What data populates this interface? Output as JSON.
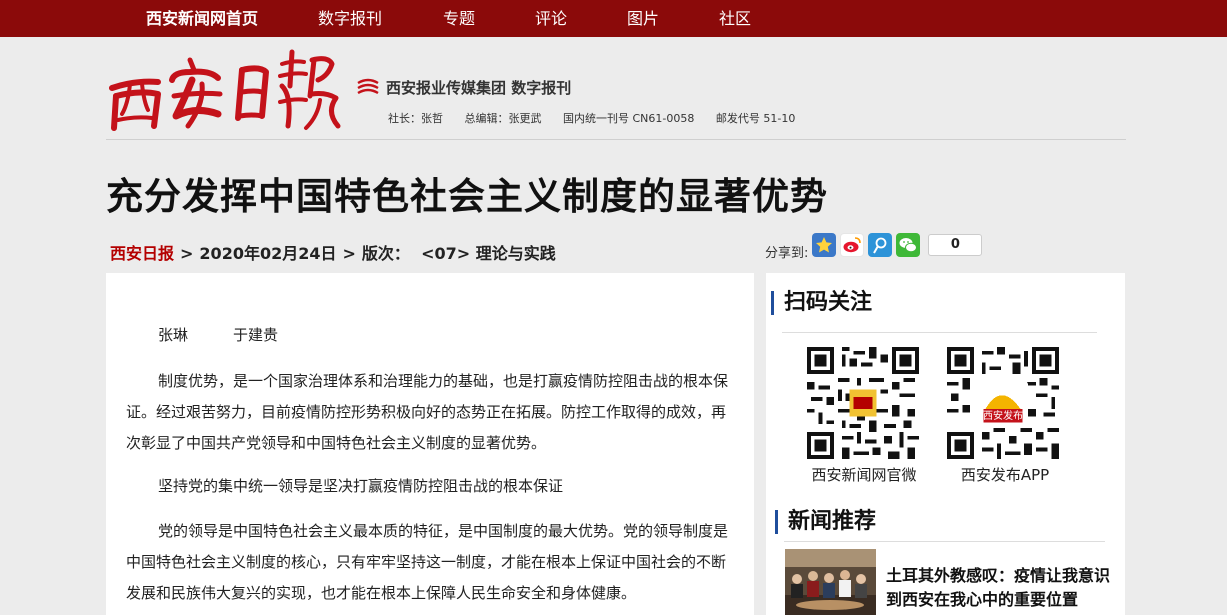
{
  "nav": {
    "items": [
      "西安新闻网首页",
      "数字报刊",
      "专题",
      "评论",
      "图片",
      "社区"
    ]
  },
  "masthead": {
    "group": "西安报业传媒集团 数字报刊",
    "publisher": "社长：张哲",
    "editor": "总编辑：张更武",
    "issn": "国内统一刊号 CN61-0058",
    "postal": "邮发代号 51-10"
  },
  "headline": "充分发挥中国特色社会主义制度的显著优势",
  "breadcrumb": {
    "paper": "西安日报",
    "date": "2020年02月24日",
    "edition_label": "版次：",
    "edition": "<07> 理论与实践"
  },
  "share": {
    "label": "分享到:",
    "icons": [
      "qzone-icon",
      "weibo-icon",
      "tencent-weibo-icon",
      "wechat-icon"
    ],
    "count": "0"
  },
  "article": {
    "paragraphs": [
      "张琳　　　于建贵",
      "制度优势，是一个国家治理体系和治理能力的基础，也是打赢疫情防控阻击战的根本保证。经过艰苦努力，目前疫情防控形势积极向好的态势正在拓展。防控工作取得的成效，再次彰显了中国共产党领导和中国特色社会主义制度的显著优势。",
      "坚持党的集中统一领导是坚决打赢疫情防控阻击战的根本保证",
      "党的领导是中国特色社会主义最本质的特征，是中国制度的最大优势。党的领导制度是中国特色社会主义制度的核心，只有牢牢坚持这一制度，才能在根本上保证中国社会的不断发展和民族伟大复兴的实现，也才能在根本上保障人民生命安全和身体健康。"
    ]
  },
  "sidebar": {
    "qr_title": "扫码关注",
    "qr_codes": [
      {
        "caption": "西安新闻网官微"
      },
      {
        "caption": "西安发布APP"
      }
    ],
    "qr_badge_text": "西安发布",
    "news_title": "新闻推荐",
    "news_item": "土耳其外教感叹：疫情让我意识到西安在我心中的重要位置"
  },
  "colors": {
    "nav_bg": "#8b0a0a",
    "brand_red": "#b40000",
    "accent_blue": "#1f4e9c"
  }
}
